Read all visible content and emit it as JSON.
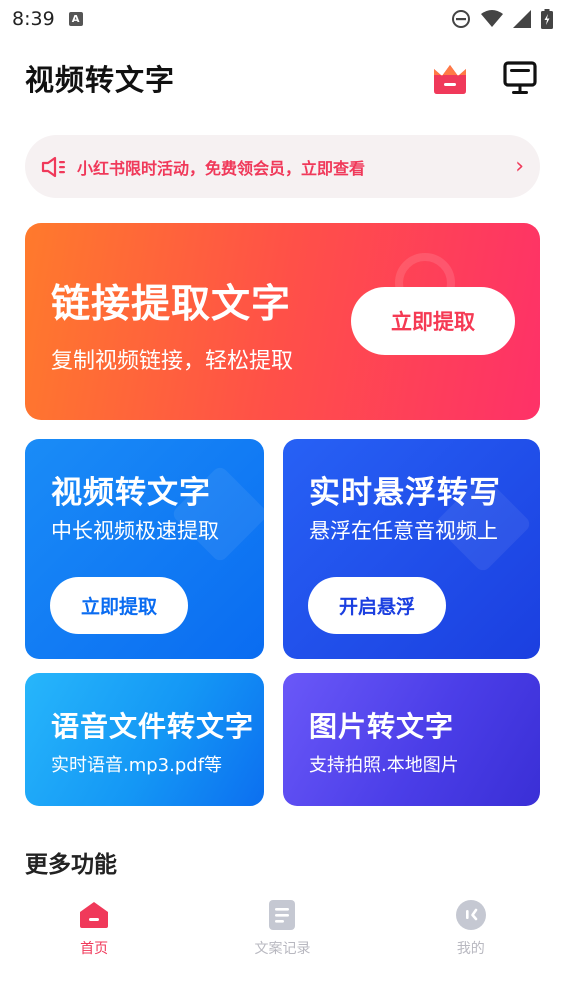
{
  "status_bar": {
    "time": "8:39",
    "notification_icon": "text-a-icon",
    "icons": [
      "do-not-disturb-icon",
      "wifi-icon",
      "signal-icon",
      "battery-icon"
    ]
  },
  "header": {
    "title": "视频转文字",
    "vip_icon": "crown-icon",
    "screen_icon": "monitor-icon"
  },
  "promo": {
    "icon": "speaker-icon",
    "text": "小红书限时活动，免费领会员，立即查看",
    "arrow": "›"
  },
  "hero": {
    "title": "链接提取文字",
    "subtitle": "复制视频链接，轻松提取",
    "button": "立即提取"
  },
  "cards": {
    "video": {
      "title": "视频转文字",
      "subtitle": "中长视频极速提取",
      "button": "立即提取"
    },
    "float": {
      "title": "实时悬浮转写",
      "subtitle": "悬浮在任意音视频上",
      "button": "开启悬浮"
    },
    "audio": {
      "title": "语音文件转文字",
      "subtitle": "实时语音.mp3.pdf等"
    },
    "image": {
      "title": "图片转文字",
      "subtitle": "支持拍照.本地图片"
    }
  },
  "more_section": {
    "title": "更多功能"
  },
  "bottom_nav": {
    "items": [
      {
        "label": "首页",
        "icon": "home-icon",
        "active": true
      },
      {
        "label": "文案记录",
        "icon": "document-icon",
        "active": false
      },
      {
        "label": "我的",
        "icon": "profile-icon",
        "active": false
      }
    ]
  },
  "colors": {
    "accent": "#f0395a",
    "hero_gradient_start": "#ff7a2c",
    "hero_gradient_end": "#fe3168",
    "video_card": "#0a6cf1",
    "float_card": "#1b3fe0",
    "audio_card": "#1497f5",
    "image_card": "#4b3ee8"
  }
}
